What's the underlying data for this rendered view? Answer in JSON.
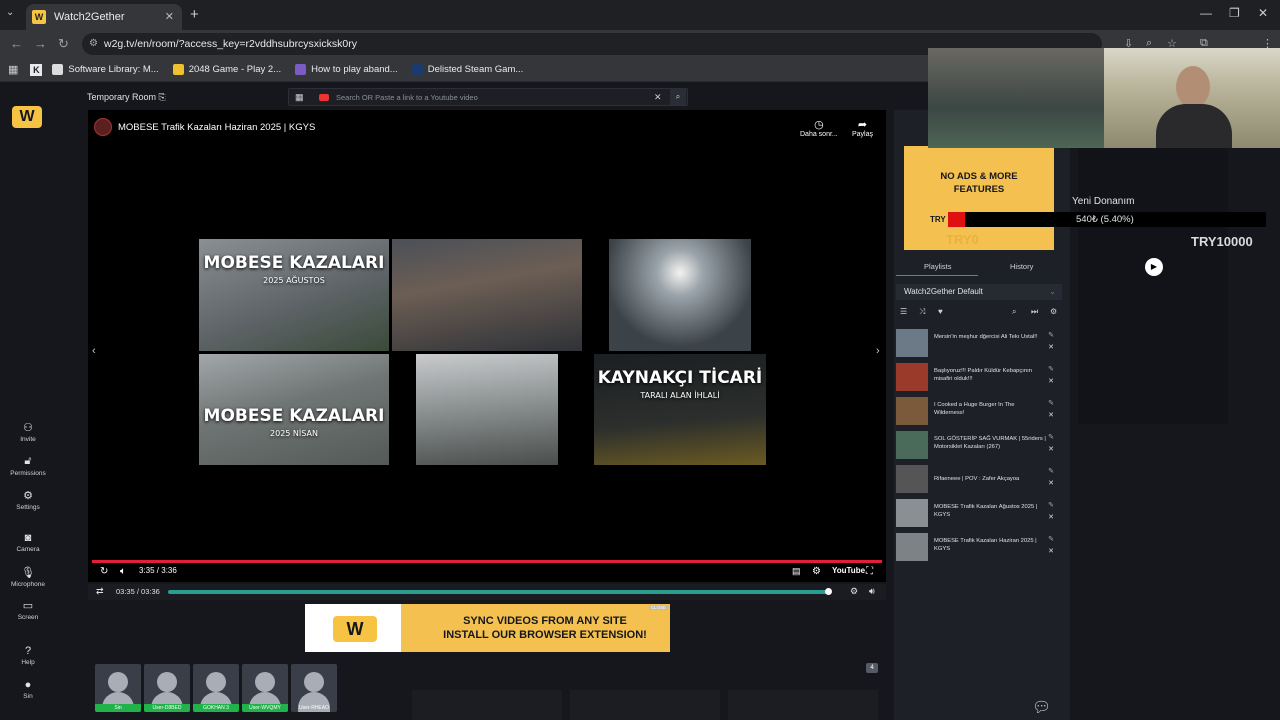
{
  "browser": {
    "tab_title": "Watch2Gether",
    "url": "w2g.tv/en/room/?access_key=r2vddhsubrcysxicksk0ry",
    "bookmarks": [
      "Software Library: M...",
      "2048 Game - Play 2...",
      "How to play aband...",
      "Delisted Steam Gam..."
    ]
  },
  "sidebar": {
    "logo": "W",
    "items": [
      {
        "label": "Invite",
        "icon": "person-add-icon"
      },
      {
        "label": "Permissions",
        "icon": "lock-open-icon"
      },
      {
        "label": "Settings",
        "icon": "gear-icon"
      },
      {
        "label": "Camera",
        "icon": "camera-icon"
      },
      {
        "label": "Microphone",
        "icon": "microphone-icon"
      },
      {
        "label": "Screen",
        "icon": "monitor-icon"
      },
      {
        "label": "Help",
        "icon": "help-icon"
      },
      {
        "label": "Sin",
        "icon": "user-icon"
      }
    ]
  },
  "room": {
    "name": "Temporary Room",
    "search_placeholder": "Search OR Paste a link to a Youtube video"
  },
  "video": {
    "title": "MOBESE Trafik Kazaları Haziran 2025 | KGYS",
    "watch_later": "Daha sonr...",
    "share": "Paylaş",
    "time": "3:35 / 3:36",
    "brand": "YouTube",
    "tiles": [
      {
        "title": "MOBESE KAZALARI",
        "sub": "2025 AĞUSTOS"
      },
      {
        "title": "MOBESE KAZALARI",
        "sub": "2025 NİSAN"
      },
      {
        "title": "KAYNAKÇI TİCARİ",
        "sub": "TARALI ALAN İHLALİ"
      }
    ]
  },
  "sync": {
    "time": "03:35 / 03:36",
    "progress": 0.995
  },
  "banner": {
    "line1": "SYNC VIDEOS FROM ANY SITE",
    "line2": "INSTALL OUR BROWSER EXTENSION!",
    "close": "CLOSE"
  },
  "users": [
    {
      "name": "Sin",
      "color": "#22b24c"
    },
    {
      "name": "User-D8BED",
      "color": "#22b24c"
    },
    {
      "name": "GOKHAN 3",
      "color": "#22b24c"
    },
    {
      "name": "User-WVQMY",
      "color": "#22b24c"
    },
    {
      "name": "User-RHEAO",
      "color": "#3a3e48"
    }
  ],
  "user_count": "4",
  "ad": {
    "line1": "NO ADS & MORE",
    "line2": "FEATURES",
    "try0": "TRY0"
  },
  "overlay": {
    "name": "Yeni Donanım",
    "value": "540₺ (5.40%)",
    "try_prefix": "TRY",
    "goal": "TRY10000",
    "fill_fraction": 0.054
  },
  "playlist": {
    "tabs": [
      "Playlists",
      "History"
    ],
    "selected": "Watch2Gether Default",
    "items": [
      "Mersin'in meşhur dğercisi Ali Tekı Ustal!!",
      "Başlıyoruz!!! Paldır Küldür Kebapçının misafiri olduk!!!",
      "I Cooked a Huge Burger In The Wilderness!",
      "SOL GÖSTERİP SAĞ VURMAK | 55riders | Motorsiklet Kazaları (267)",
      "Rifaeneee | POV : Zafer Akçayoa",
      "MOBESE Trafik Kazaları Ağustos 2025 | KGYS",
      "MOBESE Trafik Kazaları Haziran 2025 | KGYS"
    ]
  }
}
